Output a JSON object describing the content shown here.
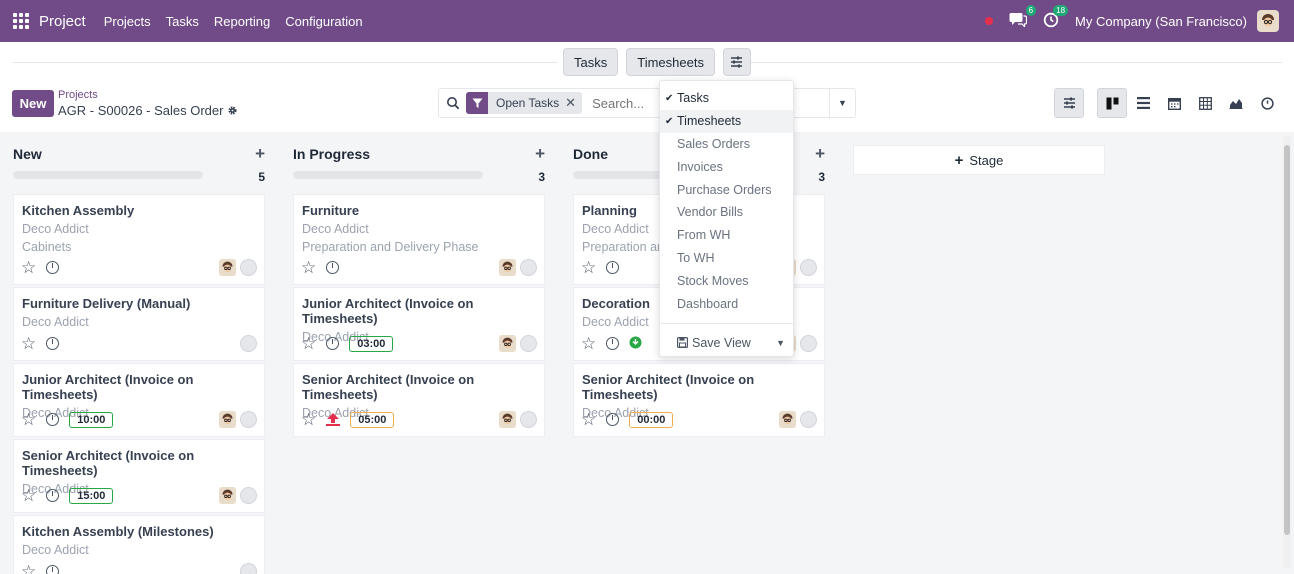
{
  "topbar": {
    "app_title": "Project",
    "menu": [
      "Projects",
      "Tasks",
      "Reporting",
      "Configuration"
    ],
    "chat_count": "6",
    "activity_count": "18",
    "company": "My Company (San Francisco)"
  },
  "view_tabs": {
    "tasks": "Tasks",
    "timesheets": "Timesheets"
  },
  "control": {
    "new_label": "New",
    "breadcrumb_parent": "Projects",
    "breadcrumb_current": "AGR - S00026 - Sales Order",
    "facet_label": "Open Tasks",
    "search_placeholder": "Search..."
  },
  "columns": [
    {
      "title": "New",
      "count": "5",
      "cards": [
        {
          "title": "Kitchen Assembly",
          "customer": "Deco Addict",
          "extra": "Cabinets"
        },
        {
          "title": "Furniture Delivery (Manual)",
          "customer": "Deco Addict"
        },
        {
          "title": "Junior Architect (Invoice on Timesheets)",
          "customer": "Deco Addict",
          "time": "10:00"
        },
        {
          "title": "Senior Architect (Invoice on Timesheets)",
          "customer": "Deco Addict",
          "time": "15:00"
        },
        {
          "title": "Kitchen Assembly (Milestones)",
          "customer": "Deco Addict"
        }
      ]
    },
    {
      "title": "In Progress",
      "count": "3",
      "cards": [
        {
          "title": "Furniture",
          "customer": "Deco Addict",
          "extra": "Preparation and Delivery Phase"
        },
        {
          "title": "Junior Architect (Invoice on Timesheets)",
          "customer": "Deco Addict",
          "time": "03:00"
        },
        {
          "title": "Senior Architect (Invoice on Timesheets)",
          "customer": "Deco Addict",
          "time": "05:00"
        }
      ]
    },
    {
      "title": "Done",
      "count": "3",
      "cards": [
        {
          "title": "Planning",
          "customer": "Deco Addict",
          "extra": "Preparation and Delivery Phase"
        },
        {
          "title": "Decoration",
          "customer": "Deco Addict"
        },
        {
          "title": "Senior Architect (Invoice on Timesheets)",
          "customer": "Deco Addict",
          "time": "00:00"
        }
      ]
    }
  ],
  "add_stage": "Stage",
  "dropdown": {
    "items": [
      "Tasks",
      "Timesheets",
      "Sales Orders",
      "Invoices",
      "Purchase Orders",
      "Vendor Bills",
      "From WH",
      "To WH",
      "Stock Moves",
      "Dashboard"
    ],
    "save_view": "Save View"
  },
  "colors": {
    "brand": "#714b87",
    "ok": "#28a745",
    "warn": "#f0ad4e",
    "danger": "#e5304d"
  }
}
